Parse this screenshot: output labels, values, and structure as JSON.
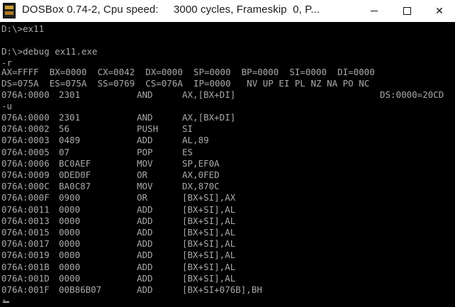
{
  "window": {
    "title": "DOSBox 0.74-2, Cpu speed:     3000 cycles, Frameskip  0, P...",
    "icon": "dosbox-icon",
    "controls": [
      "minimize",
      "maximize",
      "close"
    ],
    "close_glyph": "✕"
  },
  "console": {
    "bg": "#000000",
    "fg": "#aaaaaa",
    "prompt_lines": [
      "D:\\>ex11",
      "",
      "D:\\>debug ex11.exe",
      "-r"
    ],
    "registers": [
      "AX=FFFF  BX=0000  CX=0042  DX=0000  SP=0000  BP=0000  SI=0000  DI=0000",
      "DS=075A  ES=075A  SS=0769  CS=076A  IP=0000   NV UP EI PL NZ NA PO NC"
    ],
    "current_instr": {
      "addr": "076A:0000",
      "bytes": "2301",
      "mnemonic": "AND",
      "operands": "AX,[BX+DI]",
      "note": "DS:0000=20CD"
    },
    "u_command": "-u",
    "disasm": [
      {
        "addr": "076A:0000",
        "bytes": "2301",
        "mnemonic": "AND",
        "operands": "AX,[BX+DI]"
      },
      {
        "addr": "076A:0002",
        "bytes": "56",
        "mnemonic": "PUSH",
        "operands": "SI"
      },
      {
        "addr": "076A:0003",
        "bytes": "0489",
        "mnemonic": "ADD",
        "operands": "AL,89"
      },
      {
        "addr": "076A:0005",
        "bytes": "07",
        "mnemonic": "POP",
        "operands": "ES"
      },
      {
        "addr": "076A:0006",
        "bytes": "BC0AEF",
        "mnemonic": "MOV",
        "operands": "SP,EF0A"
      },
      {
        "addr": "076A:0009",
        "bytes": "0DED0F",
        "mnemonic": "OR",
        "operands": "AX,0FED"
      },
      {
        "addr": "076A:000C",
        "bytes": "BA0C87",
        "mnemonic": "MOV",
        "operands": "DX,870C"
      },
      {
        "addr": "076A:000F",
        "bytes": "0900",
        "mnemonic": "OR",
        "operands": "[BX+SI],AX"
      },
      {
        "addr": "076A:0011",
        "bytes": "0000",
        "mnemonic": "ADD",
        "operands": "[BX+SI],AL"
      },
      {
        "addr": "076A:0013",
        "bytes": "0000",
        "mnemonic": "ADD",
        "operands": "[BX+SI],AL"
      },
      {
        "addr": "076A:0015",
        "bytes": "0000",
        "mnemonic": "ADD",
        "operands": "[BX+SI],AL"
      },
      {
        "addr": "076A:0017",
        "bytes": "0000",
        "mnemonic": "ADD",
        "operands": "[BX+SI],AL"
      },
      {
        "addr": "076A:0019",
        "bytes": "0000",
        "mnemonic": "ADD",
        "operands": "[BX+SI],AL"
      },
      {
        "addr": "076A:001B",
        "bytes": "0000",
        "mnemonic": "ADD",
        "operands": "[BX+SI],AL"
      },
      {
        "addr": "076A:001D",
        "bytes": "0000",
        "mnemonic": "ADD",
        "operands": "[BX+SI],AL"
      },
      {
        "addr": "076A:001F",
        "bytes": "00B86B07",
        "mnemonic": "ADD",
        "operands": "[BX+SI+076B],BH"
      }
    ],
    "final_prompt": "-"
  }
}
